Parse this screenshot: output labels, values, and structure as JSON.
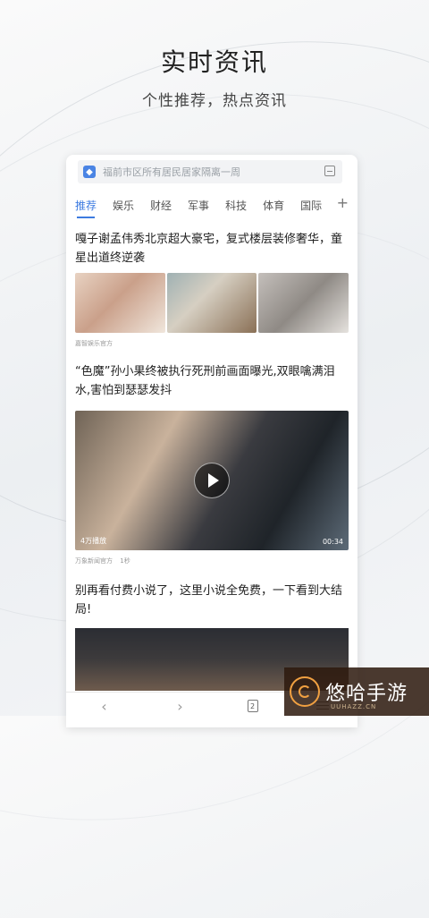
{
  "promo": {
    "headline": "实时资讯",
    "subline": "个性推荐，热点资讯"
  },
  "search": {
    "placeholder": "福前市区所有居民居家隔离一周"
  },
  "tabs": [
    {
      "label": "推荐",
      "active": true
    },
    {
      "label": "娱乐",
      "active": false
    },
    {
      "label": "财经",
      "active": false
    },
    {
      "label": "军事",
      "active": false
    },
    {
      "label": "科技",
      "active": false
    },
    {
      "label": "体育",
      "active": false
    },
    {
      "label": "国际",
      "active": false
    }
  ],
  "tab_add_label": "+",
  "articles": [
    {
      "title": "嘎子谢孟伟秀北京超大豪宅，复式楼层装修奢华，童星出道终逆袭",
      "source": "嘉智娱乐官方"
    },
    {
      "title": "“色魔”孙小果终被执行死刑前画面曝光,双眼噙满泪水,害怕到瑟瑟发抖",
      "source": "万象新闻官方",
      "extra": "1秒",
      "video_plays": "4万播放",
      "video_duration": "00:34"
    },
    {
      "title": "别再看付费小说了，这里小说全免费，一下看到大结局!"
    }
  ],
  "bottom_bar": {
    "back_glyph": "‹",
    "forward_glyph": "›",
    "page_count": "2"
  },
  "watermark": {
    "text": "悠哈手游",
    "domain": "UUHAZZ.CN"
  },
  "colors": {
    "accent": "#3d7be0",
    "text": "#222222"
  }
}
